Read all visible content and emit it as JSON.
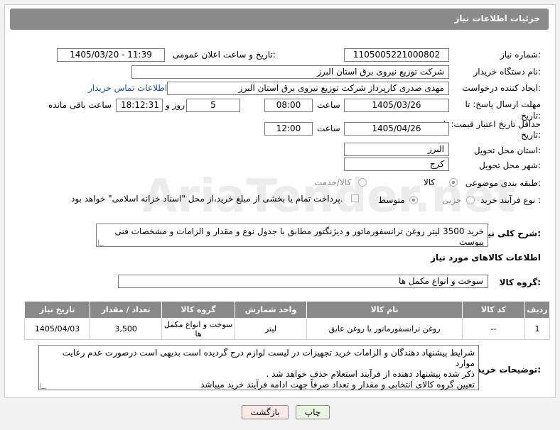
{
  "header": {
    "title": "جزئیات اطلاعات نیاز"
  },
  "labels": {
    "need_number": "شماره نیاز:",
    "announce_datetime": "تاریخ و ساعت اعلان عمومی:",
    "buyer_org": "نام دستگاه خریدار:",
    "requester": "ایجاد کننده درخواست:",
    "contact_info": "اطلاعات تماس خریدار",
    "reply_deadline": "مهلت ارسال پاسخ: تا تاریخ:",
    "time": "ساعت",
    "day_and": "روز و",
    "remaining": "ساعت باقی مانده",
    "price_validity": "حداقل تاریخ اعتبار قیمت: تا تاریخ:",
    "province": "استان محل تحویل:",
    "city": "شهر محل تحویل:",
    "category": "طبقه بندی موضوعی:",
    "process_type": "نوع فرآیند خرید :",
    "general_desc": "شرح کلی نیاز:",
    "goods_info": "اطلاعات کالاهای مورد نیاز",
    "goods_group": "گروه کالا:",
    "buyer_notes": "توضیحات خریدار:"
  },
  "values": {
    "need_number": "1105005221000802",
    "announce_datetime": "1405/03/20 - 11:39",
    "buyer_org": "شرکت توزیع نیروی برق استان البرز",
    "requester": "مهدی صدری کارپرداز شرکت توزیع نیروی برق استان البرز",
    "reply_date": "1405/03/26",
    "reply_time": "08:00",
    "days": "5",
    "remaining_time": "18:12:31",
    "validity_date": "1405/04/26",
    "validity_time": "12:00",
    "province": "البرز",
    "city": "کرج",
    "general_desc": "خرید 3500 لیتر روغن ترانسفورماتور و دیژنگتور مطابق با جدول نوع و مقدار و الزامات و مشخصات فنی پیوست",
    "goods_group": "سوخت و انواع مکمل ها"
  },
  "category_options": {
    "goods": "کالا",
    "service": "کالا/خدمت"
  },
  "process_options": {
    "partial": "جزیی",
    "medium": "متوسط",
    "payment_note": "پرداخت تمام یا بخشی از مبلغ خرید،از محل \"اسناد خزانه اسلامی\" خواهد بود."
  },
  "table": {
    "headers": [
      "ردیف",
      "کد کالا",
      "نام کالا",
      "واحد شمارش",
      "گروه کالا",
      "تعداد / مقدار",
      "تاریخ نیاز"
    ],
    "rows": [
      [
        "1",
        "--",
        "روغن ترانسفورماتور یا روغن عایق",
        "لیتر",
        "سوخت و انواع مکمل ها",
        "3,500",
        "1405/04/03"
      ]
    ]
  },
  "buyer_notes": {
    "line1": "شرایط پیشنهاد دهندگان و الزامات خرید تجهیزات در لیست لوازم درج گردیده است بدیهی است درصورت عدم رعایت موارد",
    "line2": "ذکر شده پیشنهاد دهنده از فرآیند استعلام حذف خواهد شد .",
    "line3": "تعیین گروه کالای انتخابی و مقدار و تعداد صرفاً جهت ادامه فرآیند خرید میباشد"
  },
  "buttons": {
    "print": "چاپ",
    "back": "بازگشت"
  },
  "watermark": "AriaTender.net",
  "colors": {
    "header_bg": "#8a8a8a",
    "link": "#1a4fa6",
    "print_btn": "#e8f6e0",
    "back_btn": "#fde8e8"
  }
}
